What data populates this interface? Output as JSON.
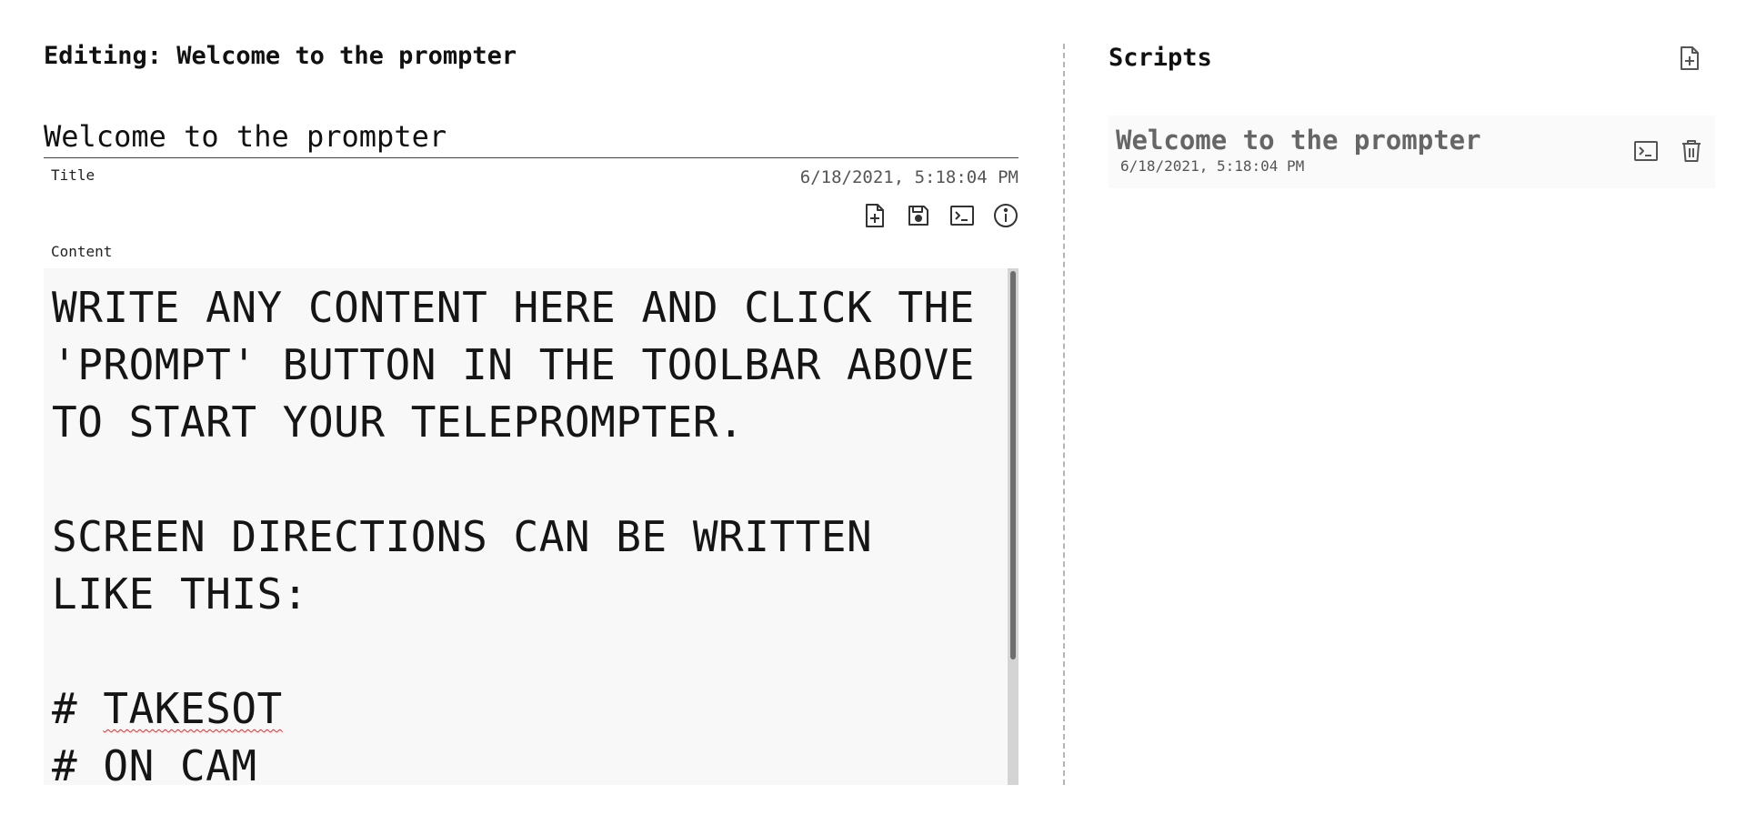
{
  "editor": {
    "heading": "Editing: Welcome to the prompter",
    "title_value": "Welcome to the prompter",
    "title_label": "Title",
    "content_label": "Content",
    "timestamp": "6/18/2021, 5:18:04 PM",
    "toolbar": [
      {
        "name": "new-script-button",
        "icon": "file-plus-icon"
      },
      {
        "name": "save-button",
        "icon": "save-icon"
      },
      {
        "name": "prompt-button",
        "icon": "terminal-icon"
      },
      {
        "name": "info-button",
        "icon": "info-icon"
      }
    ],
    "content_lines": [
      "WRITE ANY CONTENT HERE AND CLICK THE",
      "'PROMPT' BUTTON IN THE TOOLBAR ABOVE",
      "TO START YOUR TELEPROMPTER.",
      "",
      "SCREEN DIRECTIONS CAN BE WRITTEN",
      "LIKE THIS:",
      "",
      "# TAKESOT",
      "# ON CAM"
    ],
    "misspelled_word": "TAKESOT",
    "scroll_fraction_visible": 0.76
  },
  "scripts": {
    "heading": "Scripts",
    "new_button_icon": "file-plus-icon",
    "items": [
      {
        "name": "Welcome to the prompter",
        "date": "6/18/2021, 5:18:04 PM",
        "actions": [
          "terminal-icon",
          "trash-icon"
        ]
      }
    ]
  },
  "colors": {
    "text": "#111111",
    "muted_text": "#666666",
    "content_background": "#f8f8f8",
    "divider": "#b5b5b5",
    "scroll_thumb": "#6e6e6e",
    "spellcheck_underline": "#e03030"
  }
}
